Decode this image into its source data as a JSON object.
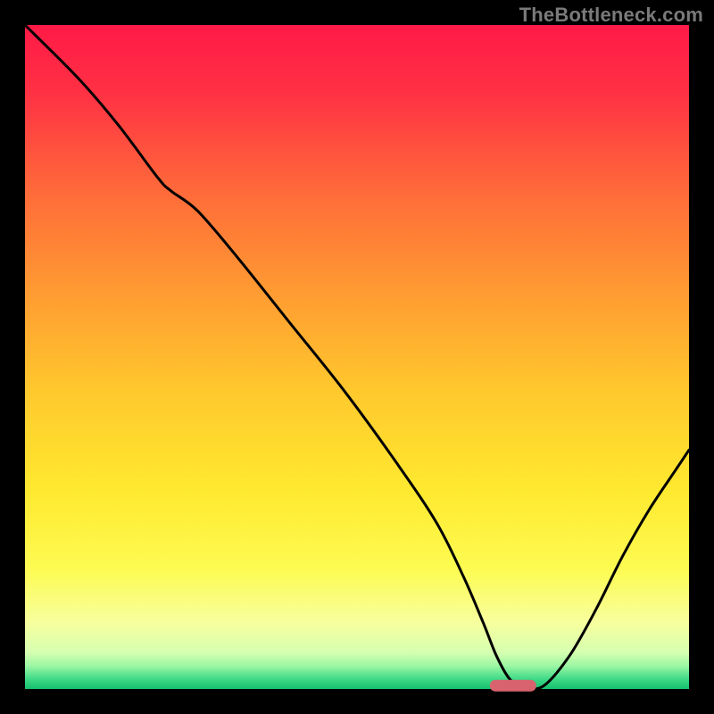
{
  "watermark": {
    "text": "TheBottleneck.com"
  },
  "chart_data": {
    "type": "line",
    "title": "",
    "xlabel": "",
    "ylabel": "",
    "xlim": [
      0,
      100
    ],
    "ylim": [
      0,
      100
    ],
    "grid": false,
    "legend": false,
    "background_gradient": {
      "stops": [
        {
          "offset": 0.0,
          "color": "#ff1a47"
        },
        {
          "offset": 0.1,
          "color": "#ff3044"
        },
        {
          "offset": 0.25,
          "color": "#ff6a3a"
        },
        {
          "offset": 0.4,
          "color": "#ff9a32"
        },
        {
          "offset": 0.55,
          "color": "#ffc82d"
        },
        {
          "offset": 0.7,
          "color": "#ffe92f"
        },
        {
          "offset": 0.82,
          "color": "#fdfb52"
        },
        {
          "offset": 0.9,
          "color": "#f7ff9e"
        },
        {
          "offset": 0.945,
          "color": "#d6ffb0"
        },
        {
          "offset": 0.965,
          "color": "#9cf7a4"
        },
        {
          "offset": 0.985,
          "color": "#3fd987"
        },
        {
          "offset": 1.0,
          "color": "#15c06e"
        }
      ]
    },
    "series": [
      {
        "name": "bottleneck-curve",
        "color": "#000000",
        "x": [
          0,
          8,
          14,
          20,
          22,
          26,
          32,
          40,
          48,
          56,
          62,
          66,
          69,
          71,
          73,
          75,
          78,
          82,
          86,
          90,
          94,
          98,
          100
        ],
        "y": [
          100,
          92,
          85,
          77,
          75,
          72,
          65,
          55,
          45,
          34,
          25,
          17,
          10,
          5,
          1.5,
          0.4,
          0.4,
          5,
          12,
          20,
          27,
          33,
          36
        ]
      }
    ],
    "marker": {
      "name": "optimal-range",
      "x_center": 73.5,
      "x_half_width": 3.5,
      "y": 0.5,
      "color": "#d8636f"
    }
  }
}
